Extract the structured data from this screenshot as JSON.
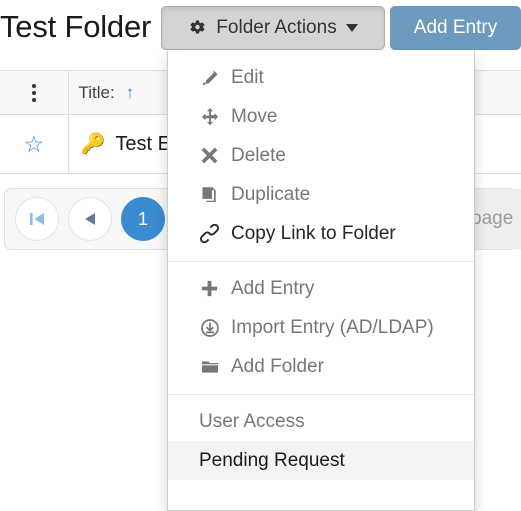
{
  "header": {
    "page_title": "Test Folder",
    "folder_actions_label": "Folder Actions",
    "folder_actions_icon": "gear-icon",
    "folder_actions_caret": "caret-down-icon",
    "add_entry_label": "Add Entry"
  },
  "table": {
    "columns": [
      {
        "key": "select",
        "label": "",
        "icon": "vertical-dots-icon"
      },
      {
        "key": "title",
        "label": "Title:",
        "sort": "ascending",
        "sort_glyph": "↑"
      }
    ],
    "rows": [
      {
        "favorite_icon": "star-outline-icon",
        "favorite_glyph": "☆",
        "type_icon": "key-icon",
        "type_glyph": "🔑",
        "title": "Test E"
      }
    ]
  },
  "pagination": {
    "first_label": "first-page",
    "prev_label": "previous-page",
    "current_page": "1",
    "next_label": "next-page",
    "per_page_text": "page"
  },
  "dropdown": {
    "groups": [
      {
        "items": [
          {
            "label": "Edit",
            "icon": "pencil-icon",
            "state": "disabled"
          },
          {
            "label": "Move",
            "icon": "move-arrows-icon",
            "state": "disabled"
          },
          {
            "label": "Delete",
            "icon": "x-cross-icon",
            "state": "disabled"
          },
          {
            "label": "Duplicate",
            "icon": "duplicate-pages-icon",
            "state": "disabled"
          },
          {
            "label": "Copy Link to Folder",
            "icon": "chain-link-icon",
            "state": "enabled"
          }
        ]
      },
      {
        "items": [
          {
            "label": "Add Entry",
            "icon": "plus-icon",
            "state": "disabled"
          },
          {
            "label": "Import Entry (AD/LDAP)",
            "icon": "download-circle-icon",
            "state": "disabled"
          },
          {
            "label": "Add Folder",
            "icon": "folder-icon",
            "state": "disabled"
          }
        ]
      },
      {
        "items": [
          {
            "label": "User Access",
            "icon": "none",
            "state": "disabled"
          },
          {
            "label": "Pending Request",
            "icon": "none",
            "state": "hovered"
          }
        ]
      }
    ]
  },
  "colors": {
    "accent_blue": "#3b8bd0",
    "button_blue": "#6e9bbd",
    "button_grey": "#d4d4d4",
    "hover_grey": "#f3f3f3",
    "text_muted": "#777777",
    "text_dark": "#262626"
  }
}
